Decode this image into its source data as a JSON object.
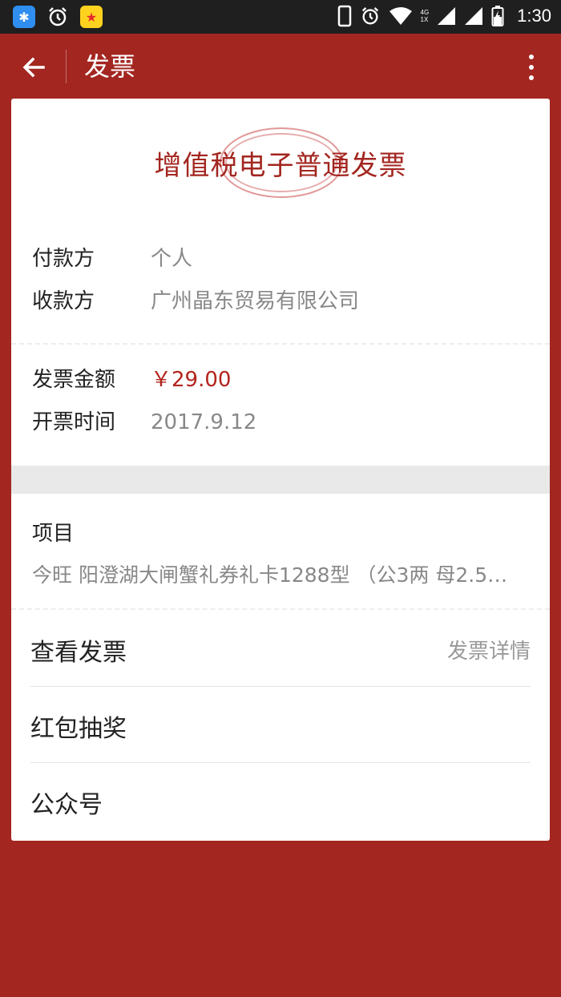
{
  "status_bar": {
    "app_icon_1": "✱",
    "app_icon_2": "★",
    "network_top": "4G",
    "network_bottom": "1X",
    "time": "1:30"
  },
  "app_bar": {
    "title": "发票"
  },
  "invoice": {
    "title": "增值税电子普通发票",
    "payer_label": "付款方",
    "payer_value": "个人",
    "payee_label": "收款方",
    "payee_value": "广州晶东贸易有限公司",
    "amount_label": "发票金额",
    "amount_value": "￥29.00",
    "date_label": "开票时间",
    "date_value": "2017.9.12",
    "items_label": "项目",
    "items_value": "今旺 阳澄湖大闸蟹礼券礼卡1288型 （公3两 母2.5…"
  },
  "menu": {
    "view_invoice_label": "查看发票",
    "view_invoice_detail": "发票详情",
    "lottery_label": "红包抽奖",
    "official_account_label": "公众号"
  },
  "colors": {
    "brand_red": "#a32620",
    "amount_red": "#b3241c"
  }
}
